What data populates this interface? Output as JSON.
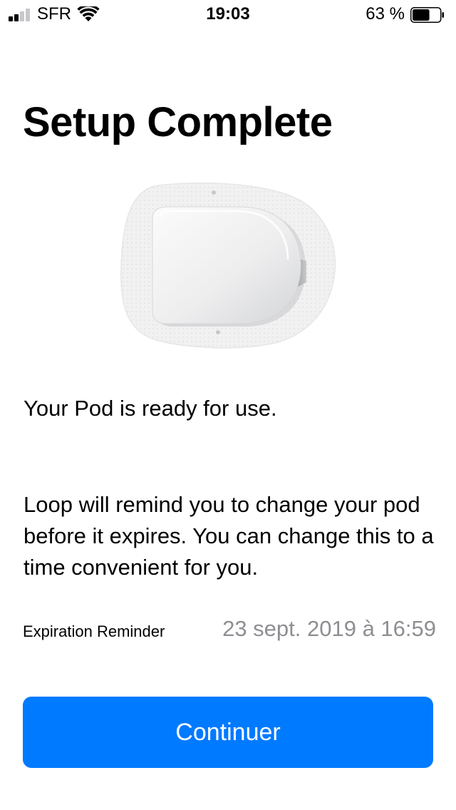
{
  "status_bar": {
    "carrier": "SFR",
    "time": "19:03",
    "battery_percent": "63 %",
    "battery_level": 0.63,
    "signal_bars_filled": 2,
    "signal_bars_total": 4
  },
  "page": {
    "title": "Setup Complete",
    "ready_message": "Your Pod is ready for use.",
    "reminder_message": "Loop will remind you to change your pod before it expires. You can change this to a time convenient for you."
  },
  "expiration": {
    "label": "Expiration Reminder",
    "value": "23 sept. 2019 à 16:59"
  },
  "actions": {
    "continue_label": "Continuer"
  },
  "colors": {
    "accent": "#007aff",
    "secondary_text": "#8e8e93",
    "signal_inactive": "#c7c7cc"
  },
  "icons": {
    "signal": "cellular-signal-icon",
    "wifi": "wifi-icon",
    "battery": "battery-icon",
    "pod": "omnipod-pod-image"
  }
}
